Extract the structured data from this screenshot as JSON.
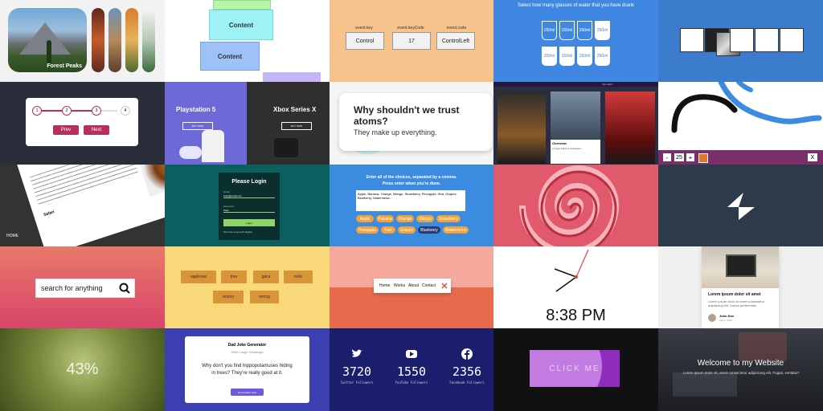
{
  "tile1": {
    "caption": "Forest Peaks"
  },
  "tile2": {
    "card_top_label": "Content",
    "card_bottom_label": "Content"
  },
  "tile3": {
    "headers": [
      "event.key",
      "event.keyCode",
      "event.code"
    ],
    "values": [
      "Control",
      "17",
      "ControlLeft"
    ]
  },
  "tile4": {
    "title": "Select how many glasses of water that you have drank",
    "cups": [
      "250ml",
      "250ml",
      "250ml",
      "250ml",
      "250ml",
      "250ml",
      "250ml",
      "250ml"
    ]
  },
  "tile6": {
    "steps": [
      "1",
      "2",
      "3",
      "4"
    ],
    "prev_label": "Prev",
    "next_label": "Next"
  },
  "tile7": {
    "left_title": "Playstation 5",
    "right_title": "Xbox Series X",
    "left_btn": "BUY NOW",
    "right_btn": "BUY NOW"
  },
  "tile8": {
    "question": "Why shouldn't we trust atoms?",
    "answer": "They make up everything."
  },
  "tile9": {
    "header": "Star Wars",
    "overview_title": "Overview",
    "overview_text": "A rogue band of resistance..."
  },
  "tile10": {
    "size_value": "25",
    "minus_label": "-",
    "plus_label": "+",
    "clear_label": "X"
  },
  "tile11": {
    "home_label": "HOME",
    "heading": "Safari",
    "nav": "HOME"
  },
  "tile12": {
    "title": "Please Login",
    "email_label": "Email",
    "email_value": "login@email.com",
    "password_label": "Password",
    "password_value": "Pass",
    "login_label": "Login",
    "footer": "Don't have an account? Register"
  },
  "tile13": {
    "instruction": "Enter all of the choices, separated by a comma.\nPress enter when you're done.",
    "textarea_value": "Apple, Banana, Orange, Mango, Strawberry, Pineapple, Kiwi, Grapes, Blueberry, Watermelon",
    "chips": [
      "Apple",
      "Banana",
      "Orange",
      "Mango",
      "Strawberry",
      "Pineapple",
      "Kiwi",
      "Grapes",
      "Blueberry",
      "Watermelon"
    ],
    "selected_chip": "Blueberry"
  },
  "tile16": {
    "search_placeholder": "search for anything"
  },
  "tile17": {
    "words": [
      "applesee",
      "tree",
      "gaca",
      "todo",
      "victory",
      "wrong"
    ]
  },
  "tile18": {
    "nav": [
      "Home",
      "Works",
      "About",
      "Contact"
    ],
    "close_icon": "close-icon"
  },
  "tile19": {
    "time": "8:38 PM"
  },
  "tile20": {
    "title": "Lorem ipsum dolor sit amet",
    "text": "Lorem ipsum dolor sit amet consectetur adipisicing elit. Dolore perferendis",
    "author": "John Doe",
    "date": "Aug 2, 2021"
  },
  "tile21": {
    "progress": "43%"
  },
  "tile22": {
    "heading": "Dad Joke Generator",
    "subheading": "Sixth Laugh Challenge",
    "joke": "Why don't you find hippopotamuses hiding in trees? They're really good at it.",
    "button": "Get Another Joke"
  },
  "tile23": {
    "counters": [
      {
        "value": "3720",
        "label": "Twitter Followers",
        "icon": "twitter-icon"
      },
      {
        "value": "1550",
        "label": "YouTube Followers",
        "icon": "youtube-icon"
      },
      {
        "value": "2356",
        "label": "Facebook Followers",
        "icon": "facebook-icon"
      }
    ]
  },
  "tile24": {
    "button": "CLICK ME"
  },
  "tile25": {
    "title": "Welcome to my Website",
    "subtitle": "Lorem ipsum dolor sit, amet consectetur adipisicing elit. Fugiat, ventatis?"
  }
}
